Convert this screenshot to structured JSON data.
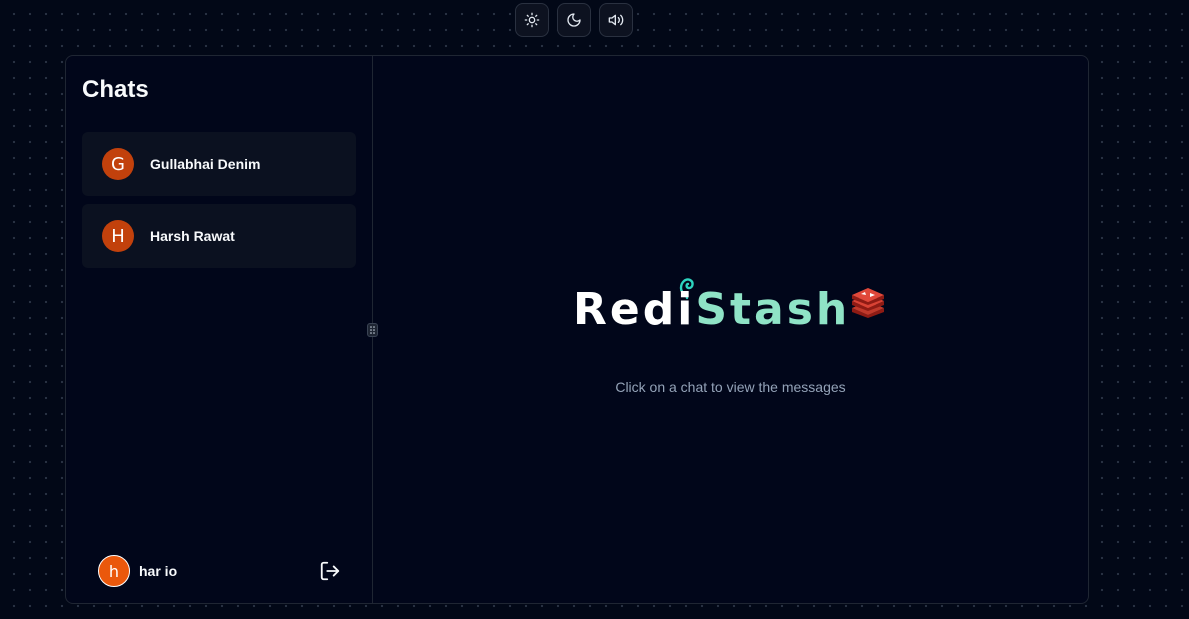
{
  "controls": {
    "light_icon": "sun-icon",
    "dark_icon": "moon-icon",
    "sound_icon": "volume-icon"
  },
  "sidebar": {
    "title": "Chats",
    "chats": [
      {
        "initial": "G",
        "name": "Gullabhai Denim"
      },
      {
        "initial": "H",
        "name": "Harsh Rawat"
      }
    ],
    "user": {
      "initial": "h",
      "name": "har io"
    },
    "logout_icon": "logout-icon"
  },
  "main": {
    "logo_part1": "Redi",
    "logo_part2": "Stash",
    "empty_text": "Click on a chat to view the messages"
  },
  "colors": {
    "background": "#020817",
    "panel": "#01061a",
    "chat_item": "#0b1120",
    "avatar": "#c2410c",
    "logo_accent": "#8fe3c6"
  }
}
